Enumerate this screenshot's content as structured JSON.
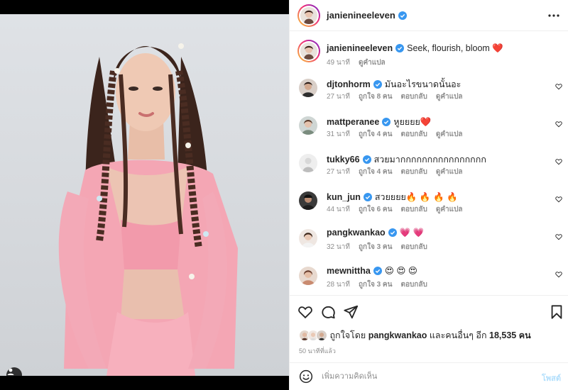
{
  "post": {
    "author": "janienineeleven",
    "author_verified": true
  },
  "caption": {
    "username": "janienineeleven",
    "text": "Seek, flourish, bloom ❤️",
    "time": "49 นาที",
    "translate": "ดูคำแปล"
  },
  "comments": [
    {
      "username": "djtonhorm",
      "text": "มันอะไรขนาดนั้นอะ",
      "time": "27 นาที",
      "likes": "ถูกใจ 8 คน",
      "reply": "ตอบกลับ",
      "translate": "ดูคำแปล"
    },
    {
      "username": "mattperanee",
      "text": "หูยยยย❤️",
      "time": "31 นาที",
      "likes": "ถูกใจ 4 คน",
      "reply": "ตอบกลับ",
      "translate": "ดูคำแปล"
    },
    {
      "username": "tukky66",
      "text": "สวยมากกกกกกกกกกกกกกกก",
      "time": "27 นาที",
      "likes": "ถูกใจ 4 คน",
      "reply": "ตอบกลับ",
      "translate": "ดูคำแปล"
    },
    {
      "username": "kun_jun",
      "text": "สวยยยย🔥 🔥 🔥 🔥",
      "time": "44 นาที",
      "likes": "ถูกใจ 6 คน",
      "reply": "ตอบกลับ",
      "translate": "ดูคำแปล"
    },
    {
      "username": "pangkwankao",
      "text": "💗 💗",
      "time": "32 นาที",
      "likes": "ถูกใจ 3 คน",
      "reply": "ตอบกลับ",
      "translate": ""
    },
    {
      "username": "mewnittha",
      "text": "😍 😍 😍",
      "time": "28 นาที",
      "likes": "ถูกใจ 3 คน",
      "reply": "ตอบกลับ",
      "translate": ""
    }
  ],
  "likes_summary": {
    "prefix": "ถูกใจโดย",
    "user": "pangkwankao",
    "middle": "และคนอื่นๆ อีก",
    "count": "18,535",
    "suffix": "คน"
  },
  "posted_ago": "50 นาทีที่แล้ว",
  "add_comment": {
    "placeholder": "เพิ่มความคิดเห็น",
    "post_label": "โพสต์"
  },
  "icons": {
    "like": "heart-icon",
    "comment": "comment-icon",
    "share": "share-icon",
    "save": "bookmark-icon",
    "more": "more-icon",
    "emoji": "emoji-icon",
    "tag": "user-tag-icon",
    "verified": "verified-badge-icon"
  },
  "colors": {
    "verified": "#3897f0",
    "post_button_disabled": "#b2dffc",
    "muted_text": "#8e8e8e",
    "text": "#262626"
  }
}
